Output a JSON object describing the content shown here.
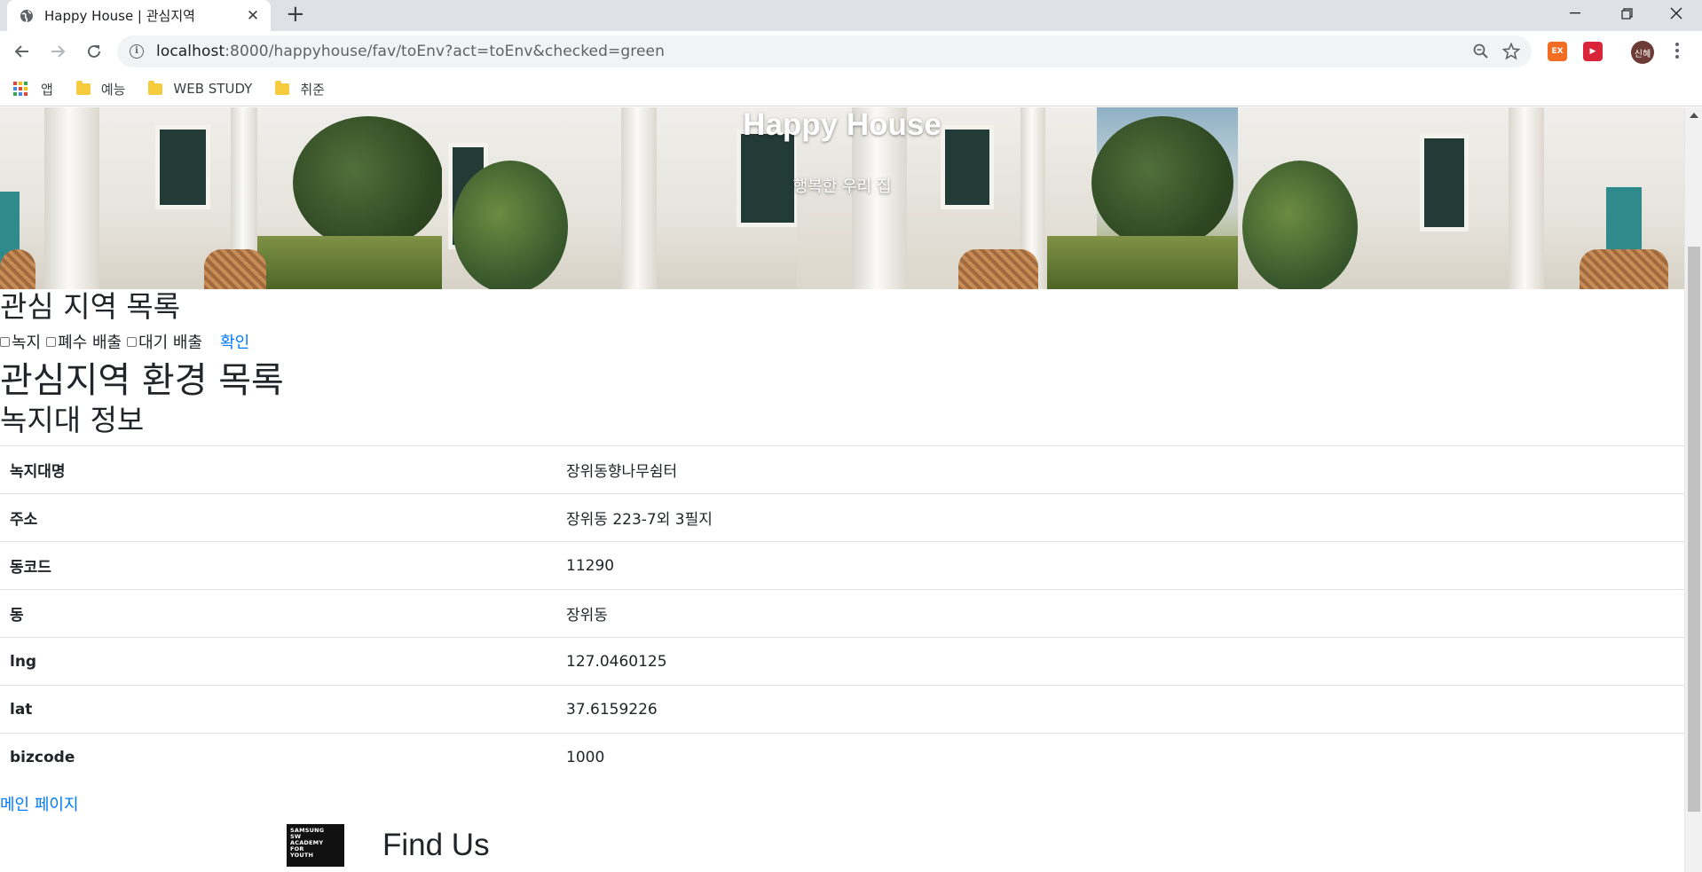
{
  "browser": {
    "tab_title": "Happy House | 관심지역",
    "url_host": "localhost",
    "url_path": ":8000/happyhouse/fav/toEnv?act=toEnv&checked=green",
    "profile_initials": "신혜",
    "bookmarks": [
      {
        "label": "앱",
        "icon": "apps-grid-icon"
      },
      {
        "label": "예능",
        "icon": "folder-icon"
      },
      {
        "label": "WEB STUDY",
        "icon": "folder-icon"
      },
      {
        "label": "취준",
        "icon": "folder-icon"
      }
    ],
    "extensions": [
      {
        "label": "EX",
        "color": "#f26c22"
      },
      {
        "label": "▶",
        "color": "#d9243a"
      }
    ]
  },
  "hero": {
    "title": "Happy House",
    "subtitle": "행복한 우리 집"
  },
  "interest": {
    "heading": "관심 지역 목록",
    "checkboxes": [
      {
        "label": "녹지",
        "checked": false
      },
      {
        "label": "폐수 배출",
        "checked": false
      },
      {
        "label": "대기 배출",
        "checked": false
      }
    ],
    "confirm_label": "확인"
  },
  "environment": {
    "heading": "관심지역 환경 목록",
    "section_title": "녹지대 정보",
    "rows": [
      {
        "key": "녹지대명",
        "value": "장위동향나무쉼터"
      },
      {
        "key": "주소",
        "value": "장위동 223-7외 3필지"
      },
      {
        "key": "동코드",
        "value": "11290"
      },
      {
        "key": "동",
        "value": "장위동"
      },
      {
        "key": "lng",
        "value": "127.0460125"
      },
      {
        "key": "lat",
        "value": "37.6159226"
      },
      {
        "key": "bizcode",
        "value": "1000"
      }
    ]
  },
  "main_page_link": "메인 페이지",
  "footer": {
    "logo_lines": [
      "SAMSUNG",
      "SW",
      "ACADEMY",
      "FOR",
      "YOUTH"
    ],
    "heading": "Find Us"
  },
  "colors": {
    "link": "#007bff",
    "tabbar": "#dee1e6",
    "omnibox": "#f1f3f4"
  }
}
